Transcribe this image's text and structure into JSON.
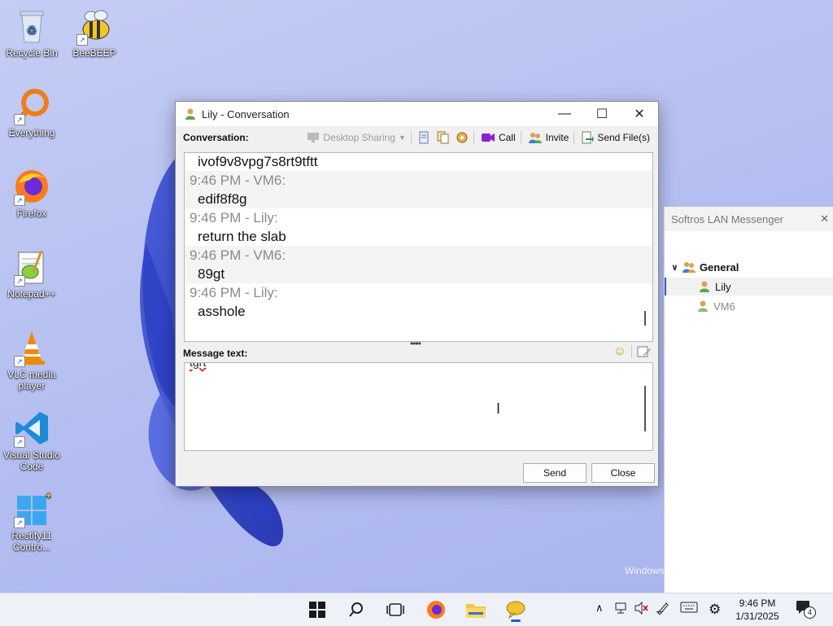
{
  "desktop": {
    "icons": [
      {
        "label": "Recycle Bin"
      },
      {
        "label": "BeeBEEP"
      },
      {
        "label": "Everything"
      },
      {
        "label": "Firefox"
      },
      {
        "label": "Notepad++"
      },
      {
        "label": "VLC media player"
      },
      {
        "label": "Visual Studio Code"
      },
      {
        "label": "Rectify11 Contro..."
      }
    ],
    "watermark": "Windows"
  },
  "conversation_window": {
    "title": "Lily - Conversation",
    "toolbar": {
      "conversation_label": "Conversation:",
      "desktop_sharing": "Desktop Sharing",
      "call": "Call",
      "invite": "Invite",
      "send_files": "Send File(s)"
    },
    "messages": [
      {
        "time_sender": "",
        "text": "ivof9v8vpg7s8rt9tftt"
      },
      {
        "time_sender": "9:46 PM - VM6:",
        "text": "edif8f8g"
      },
      {
        "time_sender": "9:46 PM - Lily:",
        "text": "return the slab"
      },
      {
        "time_sender": "9:46 PM - VM6:",
        "text": "89gt"
      },
      {
        "time_sender": "9:46 PM - Lily:",
        "text": "asshole"
      }
    ],
    "message_label": "Message text:",
    "input_value": "tgrt",
    "send_label": "Send",
    "close_label": "Close"
  },
  "messenger_panel": {
    "title": "Softros LAN Messenger",
    "group": "General",
    "users": [
      {
        "name": "Lily",
        "status": "online"
      },
      {
        "name": "VM6",
        "status": "away"
      }
    ]
  },
  "taskbar": {
    "time": "9:46 PM",
    "date": "1/31/2025",
    "notification_count": "4"
  }
}
